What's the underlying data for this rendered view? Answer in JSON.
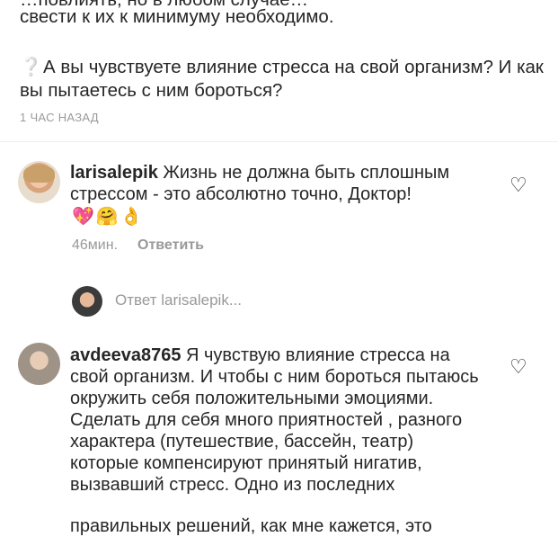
{
  "post": {
    "cut_line": "…повлиять, но в любом случае свести к их к минимуму необходимо.",
    "line2": "свести к их к минимуму необходимо.",
    "question_icon": "question-mark",
    "question": "А вы чувствуете влияние стресса на свой организм? И как вы пытаетесь с ним бороться?",
    "time": "1 ЧАС НАЗАД"
  },
  "comments": [
    {
      "username": "larisalepik",
      "text": " Жизнь не должна быть сплошным стрессом - это абсолютно точно, Доктор!",
      "emojis": "💖🤗👌",
      "time": "46мин.",
      "reply_label": "Ответить",
      "like_icon": "heart-outline"
    },
    {
      "username": "avdeeva8765",
      "text": " Я чувствую влияние стресса на свой организм. И чтобы с ним бороться пытаюсь окружить себя положительными эмоциями. Сделать для себя много приятностей , разного характера (путешествие, бассейн, театр) которые компенсируют принятый нигатив, вызвавший стресс. Одно из последних",
      "cut_line": "правильных решений, как мне кажется, это",
      "like_icon": "heart-outline"
    }
  ],
  "reply_field": {
    "placeholder": "Ответ larisalepik..."
  }
}
